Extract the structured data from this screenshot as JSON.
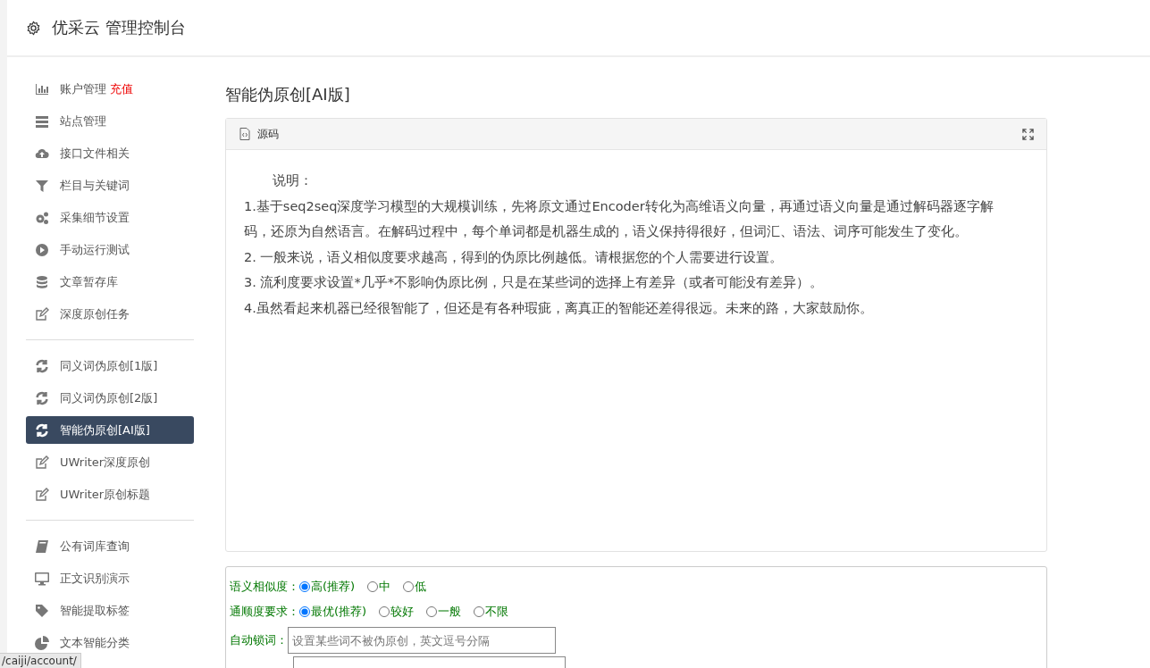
{
  "header": {
    "title": "优采云 管理控制台"
  },
  "sidebar": {
    "groups": [
      {
        "items": [
          {
            "label": "账户管理",
            "badge": "充值",
            "selected": false
          },
          {
            "label": "站点管理",
            "selected": false
          },
          {
            "label": "接口文件相关",
            "selected": false
          },
          {
            "label": "栏目与关键词",
            "selected": false
          },
          {
            "label": "采集细节设置",
            "selected": false
          },
          {
            "label": "手动运行测试",
            "selected": false
          },
          {
            "label": "文章暂存库",
            "selected": false
          },
          {
            "label": "深度原创任务",
            "selected": false
          }
        ]
      },
      {
        "items": [
          {
            "label": "同义词伪原创[1版]",
            "selected": false
          },
          {
            "label": "同义词伪原创[2版]",
            "selected": false
          },
          {
            "label": "智能伪原创[AI版]",
            "selected": true
          },
          {
            "label": "UWriter深度原创",
            "selected": false
          },
          {
            "label": "UWriter原创标题",
            "selected": false
          }
        ]
      },
      {
        "items": [
          {
            "label": "公有词库查询",
            "selected": false
          },
          {
            "label": "正文识别演示",
            "selected": false
          },
          {
            "label": "智能提取标签",
            "selected": false
          },
          {
            "label": "文本智能分类",
            "selected": false
          }
        ]
      }
    ]
  },
  "content": {
    "title": "智能伪原创[AI版]",
    "panel": {
      "tab": "源码",
      "lines": [
        "说明：",
        "1.基于seq2seq深度学习模型的大规模训练，先将原文通过Encoder转化为高维语义向量，再通过语义向量是通过解码器逐字解码，还原为自然语言。在解码过程中，每个单词都是机器生成的，语义保持得很好，但词汇、语法、词序可能发生了变化。",
        "2. 一般来说，语义相似度要求越高，得到的伪原比例越低。请根据您的个人需要进行设置。",
        "3. 流利度要求设置*几乎*不影响伪原比例，只是在某些词的选择上有差异（或者可能没有差异）。",
        "4.虽然看起来机器已经很智能了，但还是有各种瑕疵，离真正的智能还差得很远。未来的路，大家鼓励你。"
      ]
    },
    "form": {
      "radio_groups": [
        {
          "label": "语义相似度：",
          "options": [
            {
              "label": "高(推荐)",
              "selected": true
            },
            {
              "label": "中",
              "selected": false
            },
            {
              "label": "低",
              "selected": false
            }
          ]
        },
        {
          "label": "通顺度要求：",
          "options": [
            {
              "label": "最优(推荐)",
              "selected": true
            },
            {
              "label": "较好",
              "selected": false
            },
            {
              "label": "一般",
              "selected": false
            },
            {
              "label": "不限",
              "selected": false
            }
          ]
        }
      ],
      "lock": {
        "label": "自动锁词：",
        "placeholder": "设置某些词不被伪原创，英文逗号分隔"
      }
    }
  },
  "status_bar": {
    "url": "/caiji/account/"
  }
}
